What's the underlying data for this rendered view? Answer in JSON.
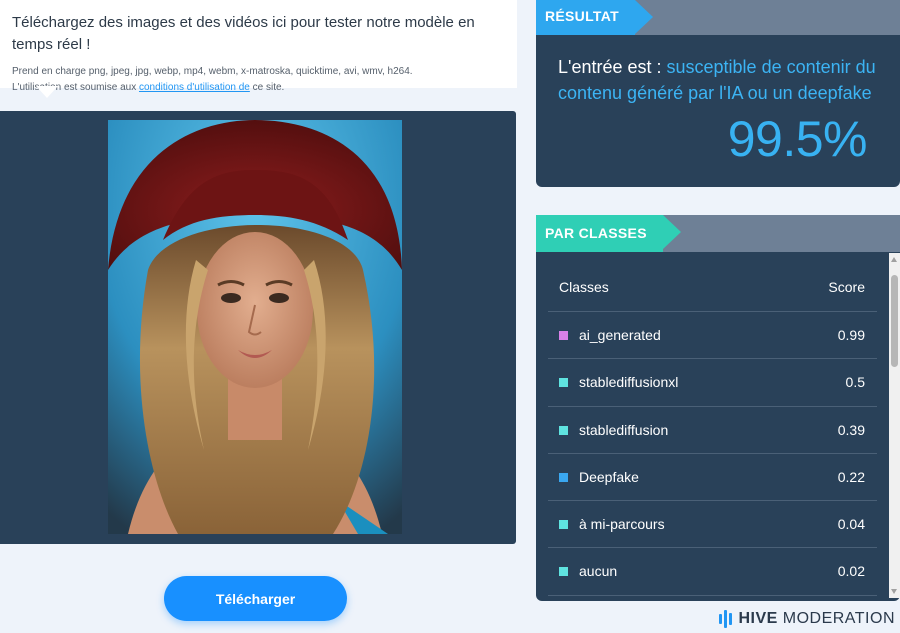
{
  "upload_info": {
    "title": "Téléchargez des images et des vidéos ici pour tester notre modèle en temps réel !",
    "formats_prefix": "Prend en charge png, jpeg, jpg, webp, mp4, webm, x-matroska, quicktime, avi, wmv, h264.",
    "terms_prefix": "L'utilisation est soumise aux ",
    "terms_link": "conditions d'utilisation de",
    "terms_suffix": " ce site."
  },
  "preview": {
    "image_alt": "portrait-photo"
  },
  "upload_button_label": "Télécharger",
  "result": {
    "tag": "RÉSULTAT",
    "prefix": "L'entrée est : ",
    "verdict": "susceptible de contenir du contenu généré par l'IA ou un deepfake",
    "percentage": "99.5%"
  },
  "classes": {
    "tag": "PAR CLASSES",
    "col_class": "Classes",
    "col_score": "Score",
    "rows": [
      {
        "label": "ai_generated",
        "score": "0.99",
        "color": "#d980e8"
      },
      {
        "label": "stablediffusionxl",
        "score": "0.5",
        "color": "#5fe3e0"
      },
      {
        "label": "stablediffusion",
        "score": "0.39",
        "color": "#5fe3e0"
      },
      {
        "label": "Deepfake",
        "score": "0.22",
        "color": "#3aa7f0"
      },
      {
        "label": "à mi-parcours",
        "score": "0.04",
        "color": "#5fe3e0"
      },
      {
        "label": "aucun",
        "score": "0.02",
        "color": "#5fe3e0"
      }
    ]
  },
  "logo": {
    "brand": "HIVE",
    "product": "MODERATION"
  },
  "colors": {
    "panel_bg": "#294159",
    "accent_blue": "#2ea7ef",
    "accent_teal": "#2fcfb5",
    "button_blue": "#1890ff"
  }
}
